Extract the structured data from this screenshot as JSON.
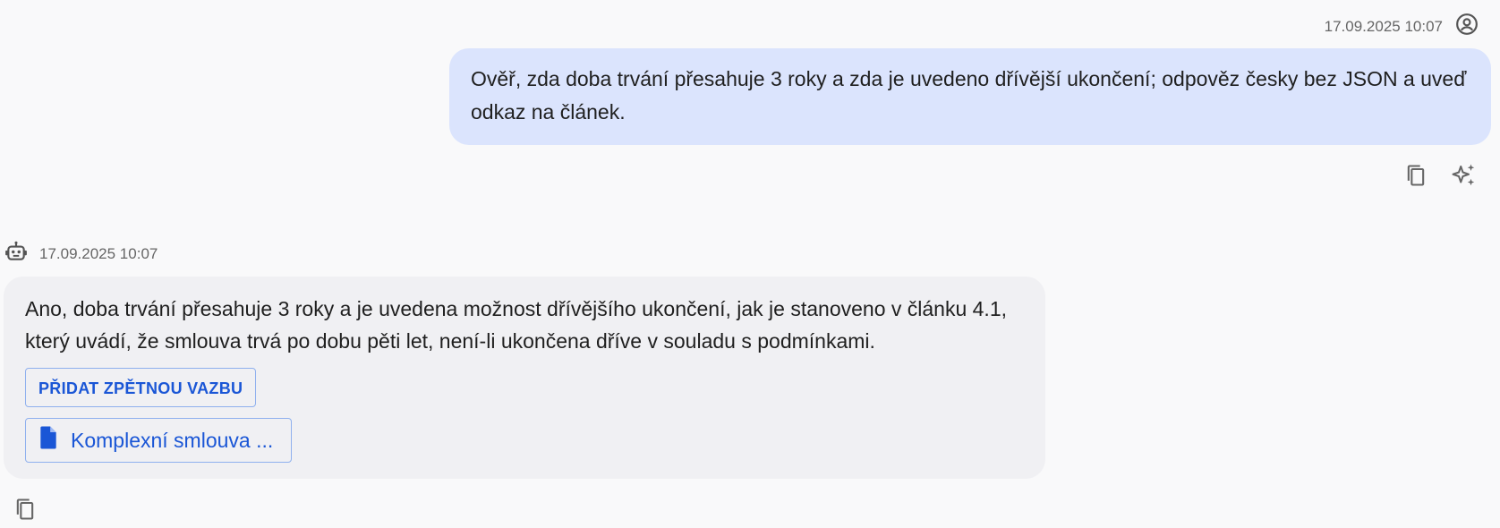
{
  "user_message": {
    "timestamp": "17.09.2025 10:07",
    "text": "Ověř, zda doba trvání přesahuje 3 roky a zda je uvedeno dřívější ukončení; odpověz česky bez JSON a uveď odkaz na článek.",
    "avatar_icon": "account-circle-icon",
    "actions": [
      {
        "icon": "copy-icon"
      },
      {
        "icon": "sparkle-icon"
      }
    ]
  },
  "assistant_message": {
    "timestamp": "17.09.2025 10:07",
    "avatar_icon": "robot-icon",
    "text": "Ano, doba trvání přesahuje 3 roky a je uvedena možnost dřívějšího ukončení, jak je stanoveno v článku 4.1, který uvádí, že smlouva trvá po dobu pěti let, není-li ukončena dříve v souladu s podmínkami.",
    "feedback_label": "PŘIDAT ZPĚTNOU VAZBU",
    "source_label": "Komplexní smlouva ...",
    "source_icon": "document-icon",
    "actions": [
      {
        "icon": "copy-icon"
      }
    ]
  },
  "colors": {
    "background": "#f9f9fa",
    "user_bubble": "#dbe4fd",
    "assistant_bubble": "#f0f0f3",
    "accent": "#1a56d6"
  }
}
